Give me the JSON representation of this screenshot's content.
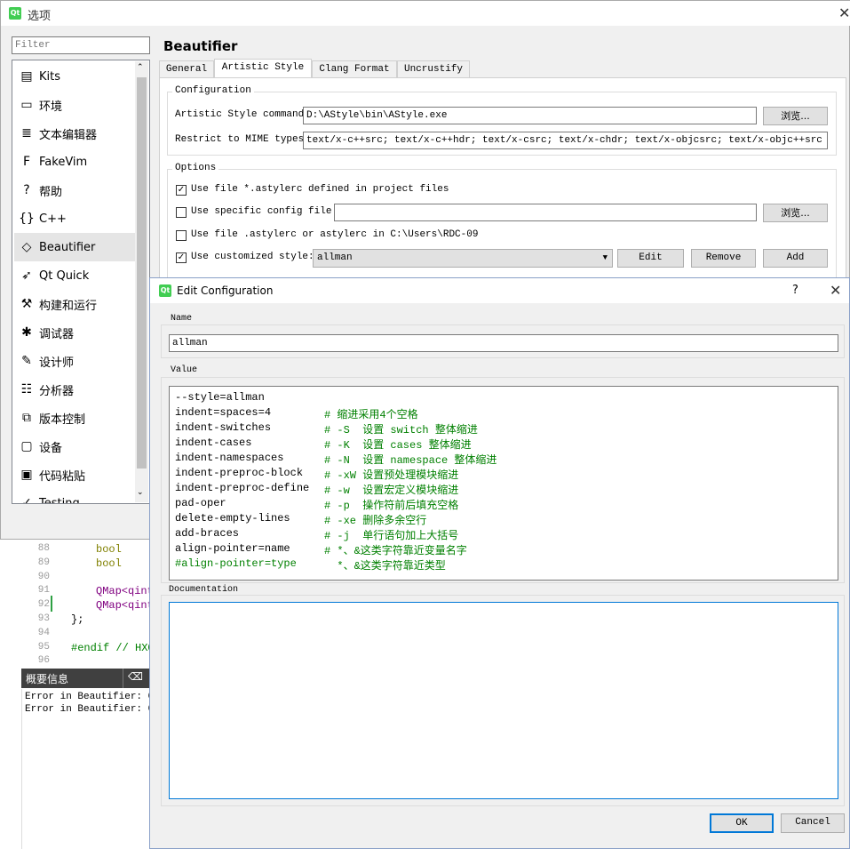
{
  "editor": {
    "lines": [
      {
        "num": "88",
        "text": "bool",
        "kind": "kw"
      },
      {
        "num": "89",
        "text": "bool",
        "kind": "kw"
      },
      {
        "num": "90",
        "text": "",
        "kind": ""
      },
      {
        "num": "91",
        "text": "QMap<qint",
        "kind": "cls"
      },
      {
        "num": "92",
        "text": "QMap<qint",
        "kind": "cls"
      },
      {
        "num": "93",
        "text": "};",
        "kind": ""
      },
      {
        "num": "94",
        "text": "",
        "kind": ""
      },
      {
        "num": "95",
        "text": "#endif // HXO",
        "kind": "cm"
      },
      {
        "num": "96",
        "text": "",
        "kind": ""
      }
    ]
  },
  "summary": {
    "title": "概要信息",
    "lines": [
      "Error in Beautifier: Can",
      "Error in Beautifier: Can"
    ]
  },
  "options_dialog": {
    "title": "选项",
    "filter_placeholder": "Filter",
    "page_title": "Beautifier",
    "sidebar": [
      {
        "label": "Kits",
        "icon": "kits-icon",
        "glyph": "▤"
      },
      {
        "label": "环境",
        "icon": "monitor-icon",
        "glyph": "▭"
      },
      {
        "label": "文本编辑器",
        "icon": "text-editor-icon",
        "glyph": "≣"
      },
      {
        "label": "FakeVim",
        "icon": "fakevim-icon",
        "glyph": "F"
      },
      {
        "label": "帮助",
        "icon": "help-icon",
        "glyph": "?"
      },
      {
        "label": "C++",
        "icon": "braces-icon",
        "glyph": "{}"
      },
      {
        "label": "Beautifier",
        "icon": "gem-icon",
        "glyph": "◇"
      },
      {
        "label": "Qt Quick",
        "icon": "qt-quick-icon",
        "glyph": "➶"
      },
      {
        "label": "构建和运行",
        "icon": "hammer-icon",
        "glyph": "⚒"
      },
      {
        "label": "调试器",
        "icon": "bug-icon",
        "glyph": "✱"
      },
      {
        "label": "设计师",
        "icon": "pencil-icon",
        "glyph": "✎"
      },
      {
        "label": "分析器",
        "icon": "analyzer-icon",
        "glyph": "☷"
      },
      {
        "label": "版本控制",
        "icon": "version-control-icon",
        "glyph": "⧉"
      },
      {
        "label": "设备",
        "icon": "device-icon",
        "glyph": "▢"
      },
      {
        "label": "代码粘贴",
        "icon": "paste-icon",
        "glyph": "▣"
      },
      {
        "label": "Testing",
        "icon": "testing-icon",
        "glyph": "✓"
      }
    ],
    "tabs": [
      "General",
      "Artistic Style",
      "Clang Format",
      "Uncrustify"
    ],
    "configuration": {
      "title": "Configuration",
      "command_label": "Artistic Style command:",
      "command_value": "D:\\AStyle\\bin\\AStyle.exe",
      "browse": "浏览...",
      "mime_label": "Restrict to MIME types:",
      "mime_value": "text/x-c++src; text/x-c++hdr; text/x-csrc; text/x-chdr; text/x-objcsrc; text/x-objc++src"
    },
    "options": {
      "title": "Options",
      "use_file_label": "Use file *.astylerc defined in project files",
      "use_specific_label": "Use specific config file:",
      "browse": "浏览...",
      "use_home_label": "Use file .astylerc or astylerc in C:\\Users\\RDC-09",
      "use_custom_label": "Use customized style:",
      "custom_value": "allman",
      "edit": "Edit",
      "remove": "Remove",
      "add": "Add"
    }
  },
  "edit_dialog": {
    "title": "Edit Configuration",
    "help": "?",
    "name_label": "Name",
    "name_value": "allman",
    "value_label": "Value",
    "value_lines": [
      {
        "code": "--style=allman",
        "comment": ""
      },
      {
        "code": "indent=spaces=4",
        "comment": "# 缩进采用4个空格"
      },
      {
        "code": "indent-switches",
        "comment": "# -S  设置 switch 整体缩进"
      },
      {
        "code": "indent-cases",
        "comment": "# -K  设置 cases 整体缩进"
      },
      {
        "code": "indent-namespaces",
        "comment": "# -N  设置 namespace 整体缩进"
      },
      {
        "code": "indent-preproc-block",
        "comment": "# -xW 设置预处理模块缩进"
      },
      {
        "code": "indent-preproc-define",
        "comment": "# -w  设置宏定义模块缩进"
      },
      {
        "code": "pad-oper",
        "comment": "# -p  操作符前后填充空格"
      },
      {
        "code": "delete-empty-lines",
        "comment": "# -xe 删除多余空行"
      },
      {
        "code": "add-braces",
        "comment": "# -j  单行语句加上大括号"
      },
      {
        "code": "align-pointer=name",
        "comment": "# *、&这类字符靠近变量名字"
      },
      {
        "code": "#align-pointer=type",
        "comment": "  *、&这类字符靠近类型"
      }
    ],
    "documentation_label": "Documentation",
    "ok": "OK",
    "cancel": "Cancel"
  }
}
